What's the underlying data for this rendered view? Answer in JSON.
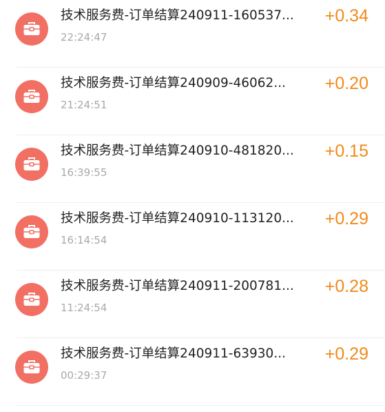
{
  "colors": {
    "icon_bg": "#f26f64",
    "amount": "#f08a1a",
    "time": "#a9a9a9",
    "title": "#222222"
  },
  "transactions": [
    {
      "icon": "toolbox-icon",
      "title": "技术服务费-订单结算240911-160537...",
      "time": "22:24:47",
      "amount": "+0.34"
    },
    {
      "icon": "toolbox-icon",
      "title": "技术服务费-订单结算240909-46062...",
      "time": "21:24:51",
      "amount": "+0.20"
    },
    {
      "icon": "toolbox-icon",
      "title": "技术服务费-订单结算240910-481820...",
      "time": "16:39:55",
      "amount": "+0.15"
    },
    {
      "icon": "toolbox-icon",
      "title": "技术服务费-订单结算240910-113120...",
      "time": "16:14:54",
      "amount": "+0.29"
    },
    {
      "icon": "toolbox-icon",
      "title": "技术服务费-订单结算240911-200781...",
      "time": "11:24:54",
      "amount": "+0.28"
    },
    {
      "icon": "toolbox-icon",
      "title": "技术服务费-订单结算240911-63930...",
      "time": "00:29:37",
      "amount": "+0.29"
    }
  ]
}
